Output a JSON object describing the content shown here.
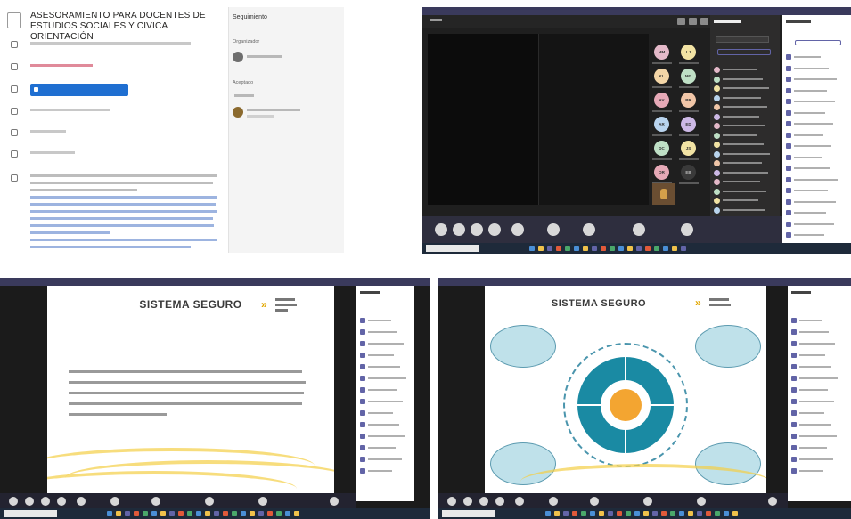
{
  "meeting": {
    "title": "ASESORAMIENTO PARA DOCENTES DE ESTUDIOS SOCIALES Y CIVICA ORIENTACIÓN"
  },
  "tracking": {
    "header": "Seguimiento",
    "organizer_label": "Organizador",
    "accepted_label": "Aceptado",
    "organizer_initials": "PC"
  },
  "call": {
    "attendee_initials": [
      "MM",
      "LJ",
      "KL",
      "MG",
      "AV",
      "BR",
      "AR",
      "ED",
      "DC",
      "JS",
      "OR",
      "EB"
    ],
    "bottom_buttons": 9,
    "attendees_panel_rows": 16,
    "chat_rows": 18
  },
  "slide1": {
    "title": "SISTEMA SEGURO",
    "chat_rows": 14
  },
  "slide2": {
    "title": "SISTEMA SEGURO",
    "chat_rows": 14
  },
  "colors": {
    "teams_purple": "#6264a7",
    "join_blue": "#1f6fd1",
    "leave_red": "#c4314b",
    "slide_yellow": "#f5cf47",
    "diagram_teal": "#1a8aa3",
    "core_orange": "#f3a531"
  }
}
